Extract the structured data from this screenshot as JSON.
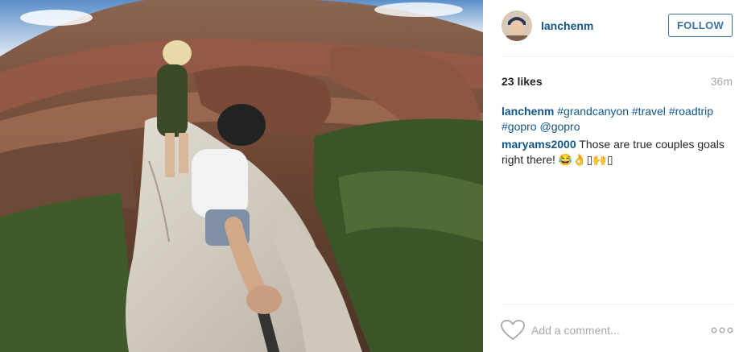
{
  "post": {
    "username": "lanchenm",
    "follow_label": "FOLLOW",
    "likes": "23 likes",
    "time_ago": "36m"
  },
  "caption": {
    "username": "lanchenm",
    "tags_line1": [
      "#grandcanyon",
      "#travel",
      "#roadtrip"
    ],
    "tags_line2": [
      "#gopro",
      "@gopro"
    ]
  },
  "comments": [
    {
      "username": "maryams2000",
      "text": "Those are true couples goals right there! 😂👌▯🙌▯"
    }
  ],
  "footer": {
    "add_comment_placeholder": "Add a comment...",
    "like_icon": "heart-icon",
    "more_icon": "more-options-icon"
  },
  "colors": {
    "link": "#125688",
    "follow_border": "#3f729b",
    "muted": "#a5a7aa"
  }
}
